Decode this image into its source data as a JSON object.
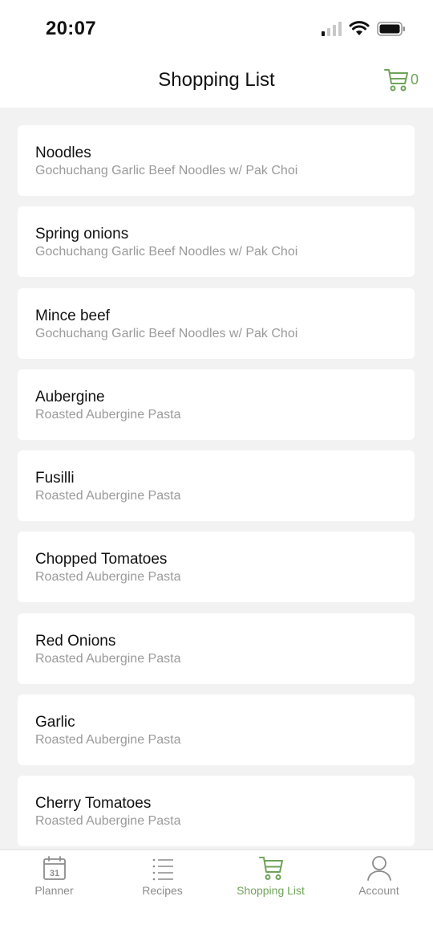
{
  "status_bar": {
    "time": "20:07"
  },
  "header": {
    "title": "Shopping List",
    "cart_count": "0"
  },
  "items": [
    {
      "name": "Noodles",
      "recipe": "Gochuchang Garlic Beef Noodles w/ Pak Choi"
    },
    {
      "name": "Spring onions",
      "recipe": "Gochuchang Garlic Beef Noodles w/ Pak Choi"
    },
    {
      "name": "Mince beef",
      "recipe": "Gochuchang Garlic Beef Noodles w/ Pak Choi"
    },
    {
      "name": "Aubergine",
      "recipe": "Roasted Aubergine Pasta"
    },
    {
      "name": "Fusilli",
      "recipe": "Roasted Aubergine Pasta"
    },
    {
      "name": "Chopped Tomatoes",
      "recipe": "Roasted Aubergine Pasta"
    },
    {
      "name": "Red Onions",
      "recipe": "Roasted Aubergine Pasta"
    },
    {
      "name": "Garlic",
      "recipe": "Roasted Aubergine Pasta"
    },
    {
      "name": "Cherry Tomatoes",
      "recipe": "Roasted Aubergine Pasta"
    }
  ],
  "tabbar": {
    "tabs": [
      {
        "label": "Planner",
        "icon": "calendar-icon",
        "calendar_day": "31",
        "active": false
      },
      {
        "label": "Recipes",
        "icon": "list-icon",
        "active": false
      },
      {
        "label": "Shopping List",
        "icon": "cart-icon",
        "active": true
      },
      {
        "label": "Account",
        "icon": "user-icon",
        "active": false
      }
    ]
  },
  "colors": {
    "accent": "#6fa35a",
    "background": "#f2f2f2",
    "card": "#ffffff",
    "muted": "#9a9a9a"
  }
}
